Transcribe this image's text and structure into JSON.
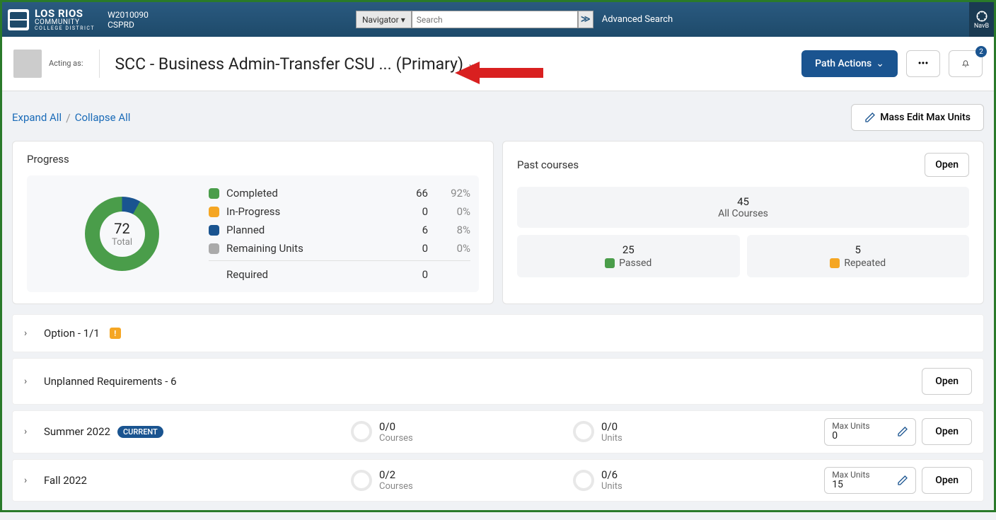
{
  "header": {
    "brand_main": "LOS RIOS",
    "brand_sub": "COMMUNITY",
    "brand_sub2": "COLLEGE DISTRICT",
    "env_id": "W2010090",
    "env_name": "CSPRD",
    "navigator_label": "Navigator",
    "search_placeholder": "Search",
    "advanced_search": "Advanced Search",
    "navb_label": "NavB"
  },
  "sub": {
    "acting_label": "Acting as:",
    "path_title": "SCC - Business Admin-Transfer CSU ...",
    "path_primary": "(Primary)",
    "path_actions": "Path Actions",
    "notif_count": "2"
  },
  "toolbar": {
    "expand_all": "Expand All",
    "collapse_all": "Collapse All",
    "mass_edit": "Mass Edit Max Units"
  },
  "progress": {
    "title": "Progress",
    "total_value": "72",
    "total_label": "Total",
    "rows": [
      {
        "label": "Completed",
        "count": "66",
        "pct": "92%",
        "swatch": "sw-green"
      },
      {
        "label": "In-Progress",
        "count": "0",
        "pct": "0%",
        "swatch": "sw-orange"
      },
      {
        "label": "Planned",
        "count": "6",
        "pct": "8%",
        "swatch": "sw-blue"
      },
      {
        "label": "Remaining Units",
        "count": "0",
        "pct": "0%",
        "swatch": "sw-grey"
      }
    ],
    "required_label": "Required",
    "required_value": "0"
  },
  "past": {
    "title": "Past courses",
    "open": "Open",
    "all_count": "45",
    "all_label": "All Courses",
    "passed_count": "25",
    "passed_label": "Passed",
    "repeated_count": "5",
    "repeated_label": "Repeated"
  },
  "sections": {
    "option": "Option - 1/1",
    "unplanned": "Unplanned Requirements - 6",
    "open": "Open"
  },
  "terms": [
    {
      "name": "Summer 2022",
      "current": true,
      "courses_frac": "0/0",
      "courses_lbl": "Courses",
      "units_frac": "0/0",
      "units_lbl": "Units",
      "max_label": "Max Units",
      "max_val": "0",
      "open": "Open"
    },
    {
      "name": "Fall 2022",
      "current": false,
      "courses_frac": "0/2",
      "courses_lbl": "Courses",
      "units_frac": "0/6",
      "units_lbl": "Units",
      "max_label": "Max Units",
      "max_val": "15",
      "open": "Open"
    }
  ],
  "chart_data": {
    "type": "pie",
    "title": "Progress",
    "categories": [
      "Completed",
      "In-Progress",
      "Planned",
      "Remaining Units"
    ],
    "values": [
      66,
      0,
      6,
      0
    ],
    "percentages": [
      92,
      0,
      8,
      0
    ],
    "total": 72,
    "required": 0
  }
}
